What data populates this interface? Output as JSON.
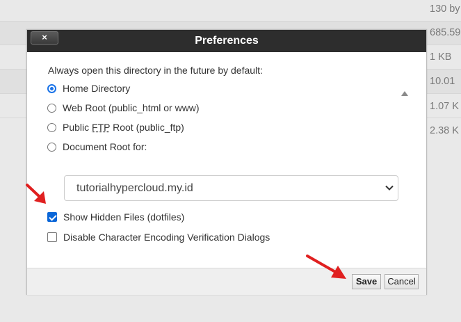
{
  "background_table": {
    "sizes": [
      "130 by",
      "685.59",
      "1 KB",
      "10.01",
      "1.07 K",
      "2.38 K"
    ]
  },
  "dialog": {
    "title": "Preferences",
    "close_label": "×",
    "prompt": "Always open this directory in the future by default:",
    "options": [
      {
        "label": "Home Directory",
        "checked": true
      },
      {
        "label": "Web Root (public_html or www)",
        "checked": false
      },
      {
        "label_pre": "Public ",
        "label_abbr": "FTP",
        "label_post": " Root (public_ftp)",
        "checked": false
      },
      {
        "label": "Document Root for:",
        "checked": false
      }
    ],
    "domain_select": {
      "value": "tutorialhypercloud.my.id"
    },
    "checkboxes": [
      {
        "label": "Show Hidden Files (dotfiles)",
        "checked": true
      },
      {
        "label": "Disable Character Encoding Verification Dialogs",
        "checked": false
      }
    ],
    "save_label": "Save",
    "cancel_label": "Cancel"
  },
  "colors": {
    "titlebar": "#2d2d2d",
    "accent": "#1a73e8",
    "annotation_arrow": "#e02020"
  },
  "icons": [
    "close-icon",
    "chevron-down-icon",
    "scroll-up-icon",
    "scroll-down-icon",
    "annotation-arrow"
  ]
}
